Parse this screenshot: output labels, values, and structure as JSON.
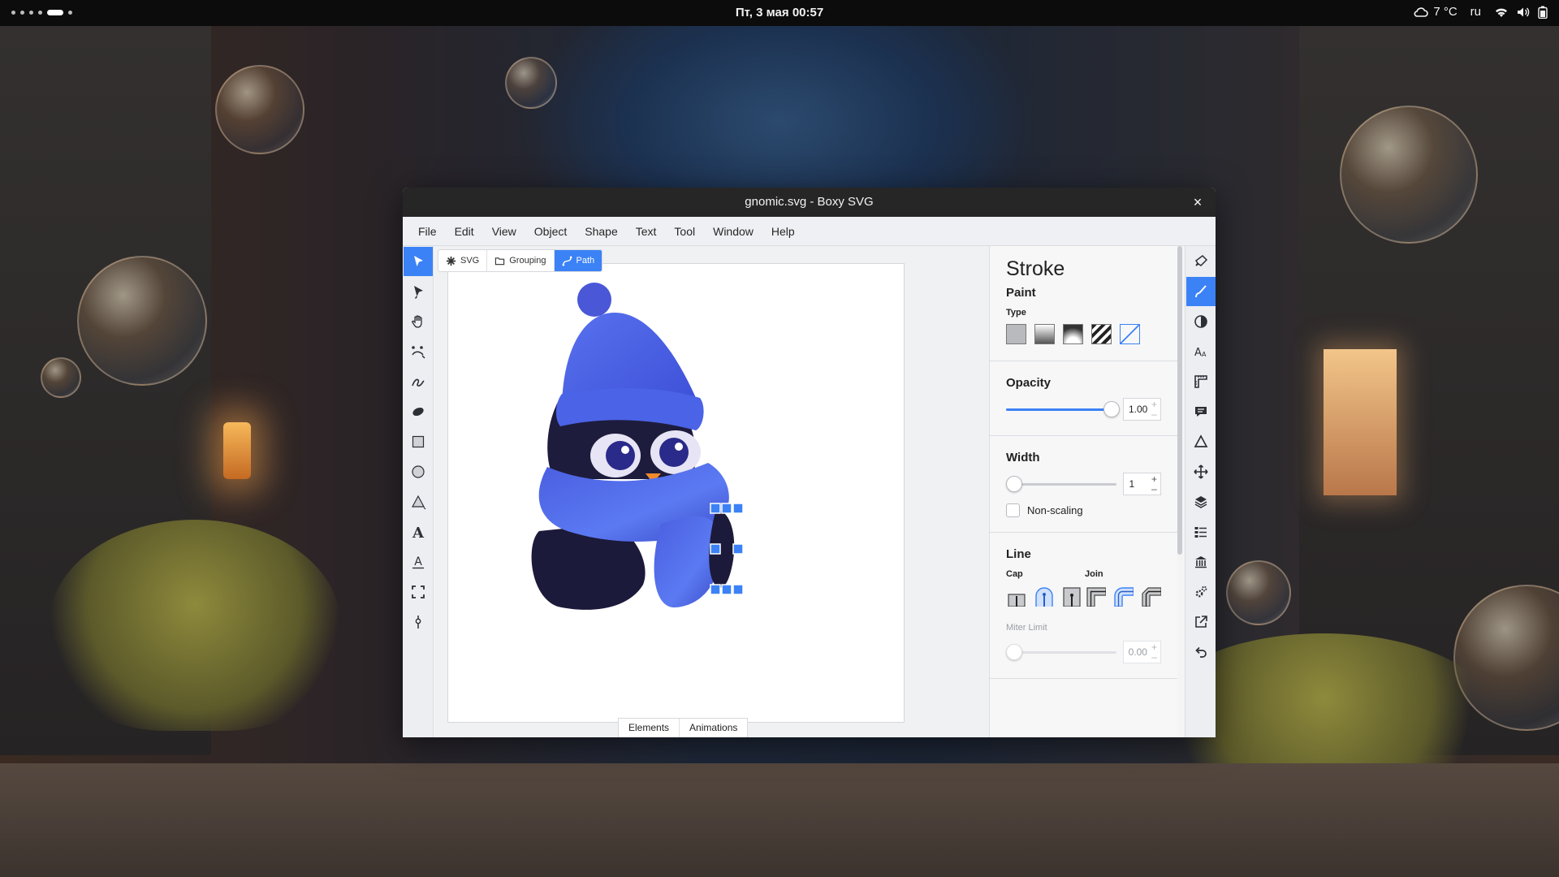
{
  "topbar": {
    "clock": "Пт, 3 мая  00:57",
    "weather": "7 °C",
    "keyboard_layout": "ru"
  },
  "window": {
    "title": "gnomic.svg - Boxy SVG",
    "close_glyph": "×"
  },
  "menu": {
    "items": [
      "File",
      "Edit",
      "View",
      "Object",
      "Shape",
      "Text",
      "Tool",
      "Window",
      "Help"
    ]
  },
  "left_tools": [
    {
      "icon": "pointer-arrow-icon",
      "active": true
    },
    {
      "icon": "node-edit-arrow-icon",
      "active": false
    },
    {
      "icon": "hand-pan-icon",
      "active": false
    },
    {
      "icon": "bezier-pen-icon",
      "active": false
    },
    {
      "icon": "freehand-pencil-icon",
      "active": false
    },
    {
      "icon": "blob-brush-icon",
      "active": false
    },
    {
      "icon": "rectangle-icon",
      "active": false
    },
    {
      "icon": "ellipse-icon",
      "active": false
    },
    {
      "icon": "triangle-icon",
      "active": false
    },
    {
      "icon": "text-icon",
      "active": false
    },
    {
      "icon": "text-on-path-icon",
      "active": false
    },
    {
      "icon": "crop-frame-icon",
      "active": false
    },
    {
      "icon": "eyedropper-icon",
      "active": false
    }
  ],
  "breadcrumb": {
    "svg": "SVG",
    "grouping": "Grouping",
    "path": "Path"
  },
  "bottom_tabs": [
    "Elements",
    "Animations"
  ],
  "panel": {
    "title": "Stroke",
    "paint": {
      "heading": "Paint",
      "type_label": "Type",
      "types": [
        "solid-paint-icon",
        "linear-gradient-icon",
        "radial-gradient-icon",
        "pattern-icon",
        "none-paint-icon"
      ],
      "selected_type": "none-paint-icon"
    },
    "opacity": {
      "label": "Opacity",
      "value": "1.00",
      "fraction": 1.0
    },
    "width": {
      "label": "Width",
      "value": "1",
      "fraction": 0.0,
      "non_scaling_label": "Non-scaling"
    },
    "line": {
      "heading": "Line",
      "cap_label": "Cap",
      "join_label": "Join",
      "caps": [
        "butt-cap-icon",
        "round-cap-icon",
        "square-cap-icon"
      ],
      "selected_cap": "round-cap-icon",
      "joins": [
        "miter-join-icon",
        "round-join-icon",
        "bevel-join-icon"
      ],
      "selected_join": "round-join-icon",
      "miter_label": "Miter Limit",
      "miter_value": "0.00"
    }
  },
  "right_tools": [
    "brush-fill-icon",
    "stroke-brush-icon",
    "contrast-icon",
    "typography-icon",
    "ruler-icon",
    "comment-icon",
    "triangle-outline-icon",
    "move-arrows-icon",
    "layers-icon",
    "list-icon",
    "library-icon",
    "gears-icon",
    "export-icon",
    "undo-icon"
  ],
  "colors": {
    "accent": "#3b82f6",
    "penguin_blue": "#4f63e0",
    "penguin_dark": "#1c1a3a"
  }
}
